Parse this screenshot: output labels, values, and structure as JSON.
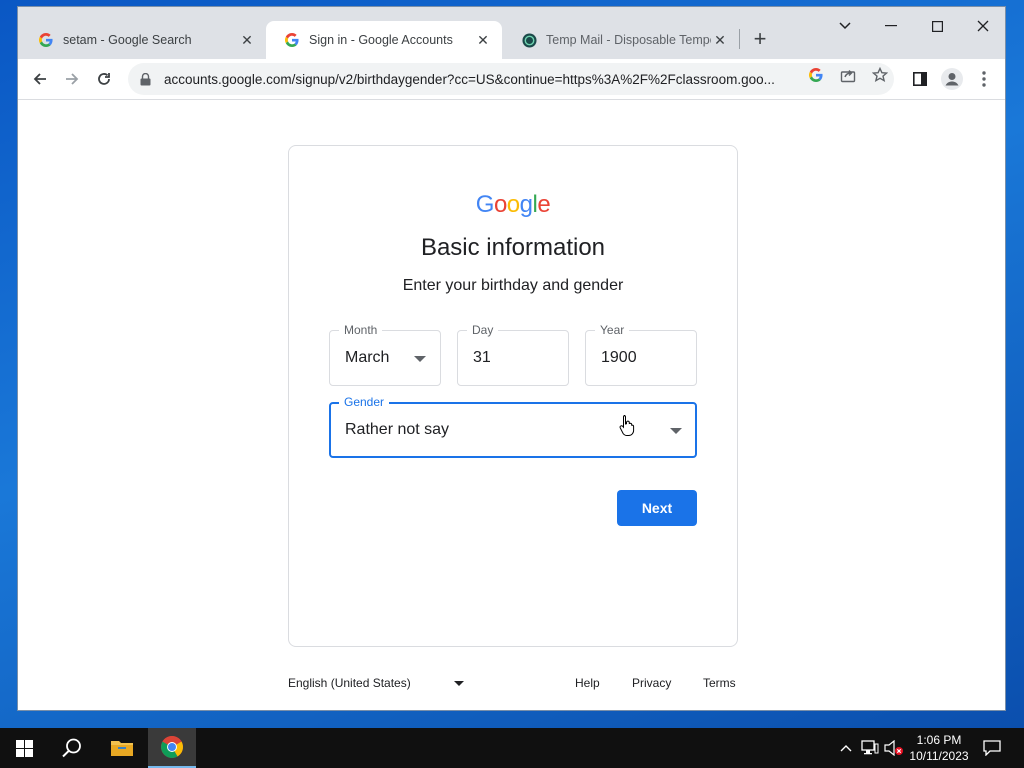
{
  "browser": {
    "tabs": [
      {
        "title": "setam - Google Search",
        "favicon": "google-g-icon",
        "active": false
      },
      {
        "title": "Sign in - Google Accounts",
        "favicon": "google-g-icon",
        "active": true
      },
      {
        "title": "Temp Mail - Disposable Tempora",
        "favicon": "tempmail-icon",
        "active": false
      }
    ],
    "url": "accounts.google.com/signup/v2/birthdaygender?cc=US&continue=https%3A%2F%2Fclassroom.goo..."
  },
  "page": {
    "logo_text": "Google",
    "heading": "Basic information",
    "subheading": "Enter your birthday and gender",
    "month": {
      "label": "Month",
      "value": "March"
    },
    "day": {
      "label": "Day",
      "value": "31"
    },
    "year": {
      "label": "Year",
      "value": "1900"
    },
    "gender": {
      "label": "Gender",
      "value": "Rather not say"
    },
    "next_label": "Next"
  },
  "footer": {
    "language": "English (United States)",
    "help": "Help",
    "privacy": "Privacy",
    "terms": "Terms"
  },
  "taskbar": {
    "time": "1:06 PM",
    "date": "10/11/2023"
  },
  "colors": {
    "accent": "#1a73e8",
    "google_blue": "#4285f4",
    "google_red": "#ea4335",
    "google_yellow": "#fbbc05",
    "google_green": "#34a853"
  }
}
